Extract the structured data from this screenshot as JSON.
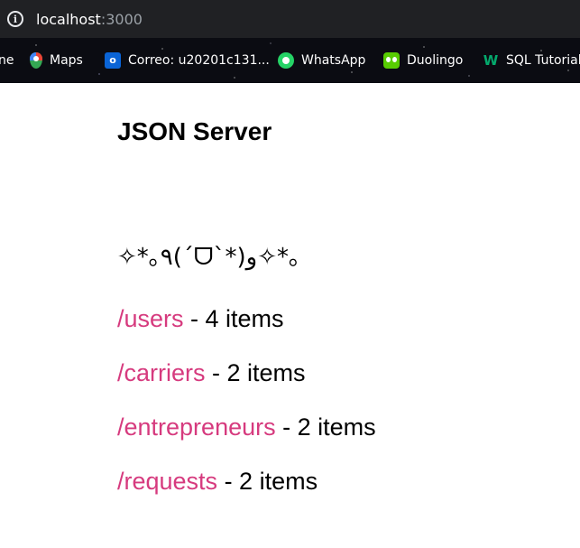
{
  "address_bar": {
    "host": "localhost",
    "port": ":3000"
  },
  "bookmarks": [
    {
      "label": "Maps",
      "icon": "maps-icon"
    },
    {
      "label": "Correo: u20201c131...",
      "icon": "outlook-icon"
    },
    {
      "label": "WhatsApp",
      "icon": "whatsapp-icon"
    },
    {
      "label": "Duolingo",
      "icon": "duolingo-icon"
    },
    {
      "label": "SQL Tutorial",
      "icon": "w3schools-icon"
    }
  ],
  "bookmark_partial_left": "ne",
  "page": {
    "title": "JSON Server",
    "kaomoji": "✧*｡٩(ˊᗜˋ*)و✧*｡",
    "resources": [
      {
        "path": "/users",
        "count_text": " - 4 items"
      },
      {
        "path": "/carriers",
        "count_text": " - 2 items"
      },
      {
        "path": "/entrepreneurs",
        "count_text": " - 2 items"
      },
      {
        "path": "/requests",
        "count_text": " - 2 items"
      }
    ]
  },
  "colors": {
    "link": "#d63a7e",
    "browser_chrome": "#202124"
  }
}
